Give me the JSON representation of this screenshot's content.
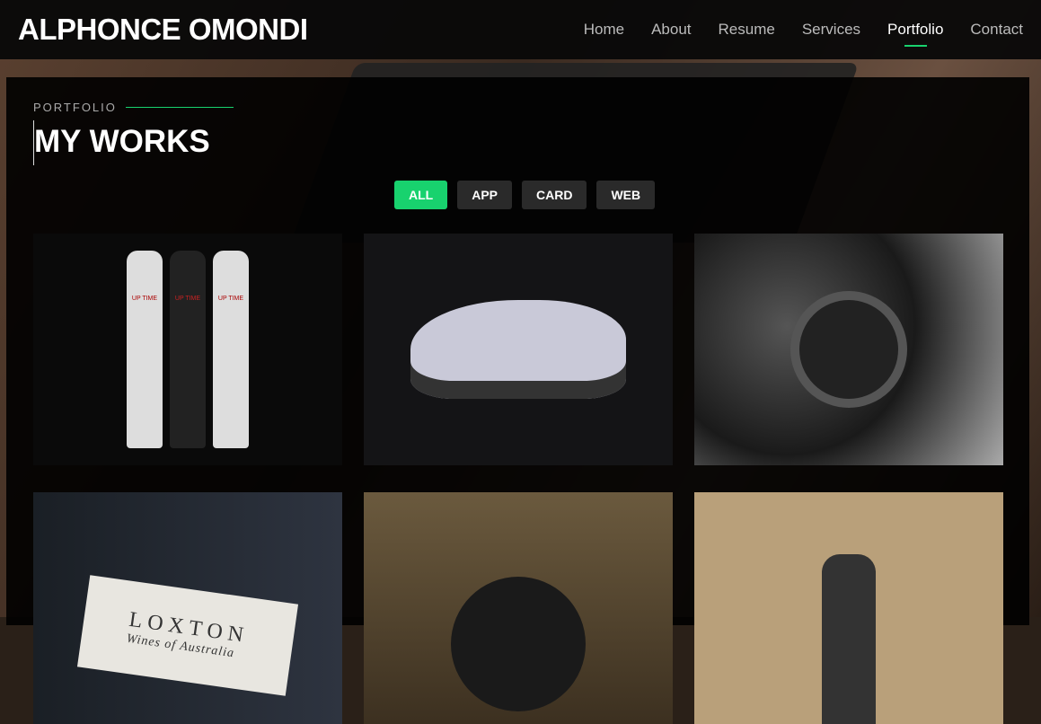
{
  "header": {
    "logo": "ALPHONCE OMONDI",
    "nav": [
      "Home",
      "About",
      "Resume",
      "Services",
      "Portfolio",
      "Contact"
    ],
    "active": "Portfolio"
  },
  "section": {
    "subtitle": "PORTFOLIO",
    "title": "MY WORKS"
  },
  "filters": [
    {
      "label": "ALL",
      "active": true
    },
    {
      "label": "APP"
    },
    {
      "label": "CARD"
    },
    {
      "label": "WEB"
    }
  ],
  "items": {
    "bottle_brand": "UP TIME",
    "wine_brand": "LOXTON",
    "wine_sub": "Wines of Australia"
  },
  "colors": {
    "accent": "#18d26e"
  }
}
